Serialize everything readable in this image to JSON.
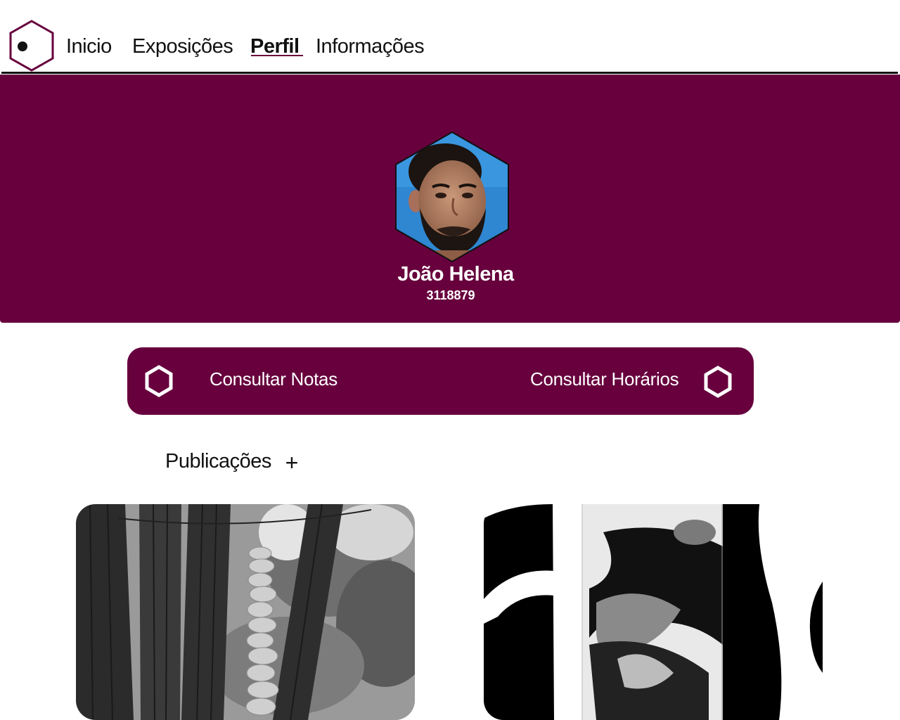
{
  "nav": {
    "logo_icon": "hexagon-dot-logo-icon",
    "links": [
      "Inicio",
      "Exposições",
      "Perfil",
      "Informações"
    ],
    "active": "Perfil"
  },
  "profile": {
    "name": "João Helena",
    "id": "3118879",
    "avatar": "profile-photo-hexagon"
  },
  "actions": {
    "grades_label": "Consultar Notas",
    "schedule_label": "Consultar Horários",
    "icon": "hexagon-outline-icon"
  },
  "publications": {
    "title": "Publicações",
    "add_label": "+",
    "posts": [
      {
        "image": "tree-stone-stack-photo"
      },
      {
        "image": "abstract-black-white-art"
      }
    ]
  },
  "colors": {
    "brand": "#67003d",
    "text": "#111111",
    "background": "#ffffff"
  }
}
